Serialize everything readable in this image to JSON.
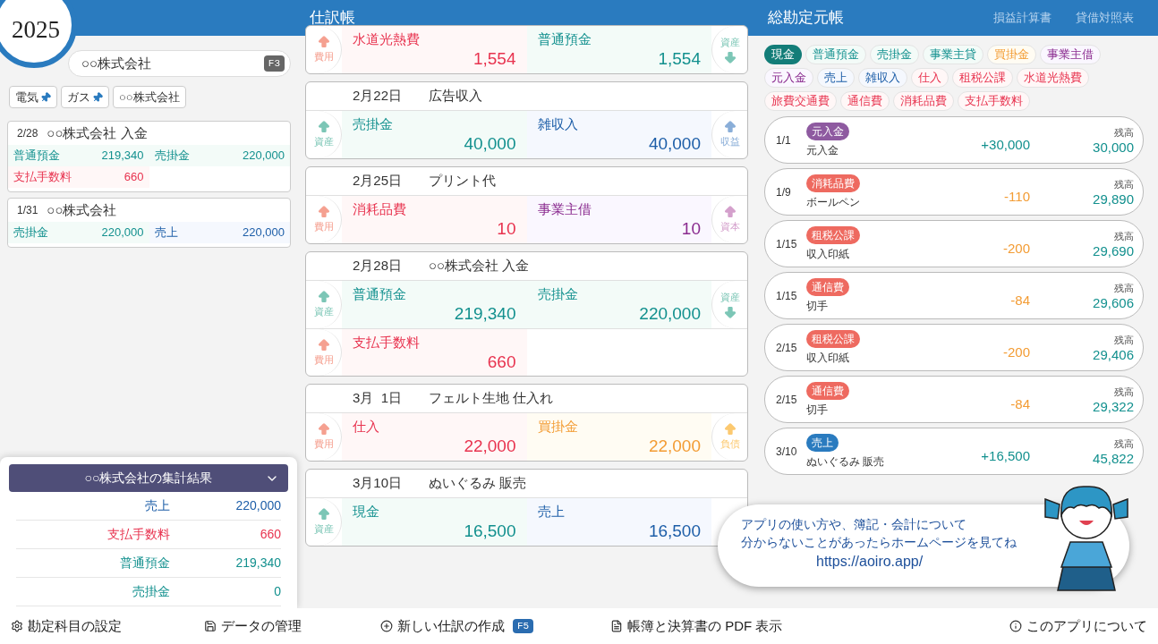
{
  "year": "2025",
  "header": {
    "journal_title": "仕訳帳",
    "ledger_title": "総勘定元帳",
    "links": [
      "損益計算書",
      "貸借対照表"
    ]
  },
  "search": {
    "value": "○○株式会社",
    "shortcut": "F3"
  },
  "chips": [
    {
      "label": "電気",
      "pinned": true
    },
    {
      "label": "ガス",
      "pinned": true
    },
    {
      "label": "○○株式会社",
      "pinned": false
    }
  ],
  "results": [
    {
      "date": "2/28",
      "title": "○○株式会社 入金",
      "cells": [
        {
          "account": "普通預金",
          "amount": "219,340",
          "kind": "asset"
        },
        {
          "account": "売掛金",
          "amount": "220,000",
          "kind": "asset"
        },
        {
          "account": "支払手数料",
          "amount": "660",
          "kind": "expense"
        }
      ]
    },
    {
      "date": "1/31",
      "title": "○○株式会社",
      "cells": [
        {
          "account": "売掛金",
          "amount": "220,000",
          "kind": "asset"
        },
        {
          "account": "売上",
          "amount": "220,000",
          "kind": "revenue"
        }
      ]
    }
  ],
  "summary": {
    "title": "○○株式会社の集計結果",
    "rows": [
      {
        "label": "売上",
        "amount": "220,000",
        "kind": "revenue"
      },
      {
        "label": "支払手数料",
        "amount": "660",
        "kind": "expense"
      },
      {
        "label": "普通預金",
        "amount": "219,340",
        "kind": "asset"
      },
      {
        "label": "売掛金",
        "amount": "0",
        "kind": "asset"
      }
    ]
  },
  "journal": [
    {
      "rows": [
        {
          "left_tag": "費用",
          "left_increase": true,
          "debit": {
            "account": "水道光熱費",
            "amount": "1,554",
            "kind": "expense"
          },
          "credit": {
            "account": "普通預金",
            "amount": "1,554",
            "kind": "asset"
          },
          "right_tag": "資産",
          "right_increase": false
        }
      ]
    },
    {
      "date": "2月22日",
      "title": "広告収入",
      "rows": [
        {
          "left_tag": "資産",
          "left_increase": true,
          "debit": {
            "account": "売掛金",
            "amount": "40,000",
            "kind": "asset"
          },
          "credit": {
            "account": "雑収入",
            "amount": "40,000",
            "kind": "revenue"
          },
          "right_tag": "収益",
          "right_increase": true
        }
      ]
    },
    {
      "date": "2月25日",
      "title": "プリント代",
      "rows": [
        {
          "left_tag": "費用",
          "left_increase": true,
          "debit": {
            "account": "消耗品費",
            "amount": "10",
            "kind": "expense"
          },
          "credit": {
            "account": "事業主借",
            "amount": "10",
            "kind": "equity"
          },
          "right_tag": "資本",
          "right_increase": true
        }
      ]
    },
    {
      "date": "2月28日",
      "title": "○○株式会社 入金",
      "rows": [
        {
          "left_tag": "資産",
          "left_increase": true,
          "debit": {
            "account": "普通預金",
            "amount": "219,340",
            "kind": "asset"
          },
          "credit": {
            "account": "売掛金",
            "amount": "220,000",
            "kind": "asset"
          },
          "right_tag": "資産",
          "right_increase": false
        },
        {
          "left_tag": "費用",
          "left_increase": true,
          "debit": {
            "account": "支払手数料",
            "amount": "660",
            "kind": "expense"
          }
        }
      ]
    },
    {
      "date": "3月  1日",
      "title": "フェルト生地 仕入れ",
      "rows": [
        {
          "left_tag": "費用",
          "left_increase": true,
          "debit": {
            "account": "仕入",
            "amount": "22,000",
            "kind": "expense"
          },
          "credit": {
            "account": "買掛金",
            "amount": "22,000",
            "kind": "liability"
          },
          "right_tag": "負債",
          "right_increase": true
        }
      ]
    },
    {
      "date": "3月10日",
      "title": "ぬいぐるみ 販売",
      "rows": [
        {
          "left_tag": "資産",
          "left_increase": true,
          "debit": {
            "account": "現金",
            "amount": "16,500",
            "kind": "asset"
          },
          "credit": {
            "account": "売上",
            "amount": "16,500",
            "kind": "revenue"
          }
        }
      ]
    }
  ],
  "accounts": [
    {
      "label": "現金",
      "kind": "asset",
      "selected": true
    },
    {
      "label": "普通預金",
      "kind": "asset",
      "selected": false
    },
    {
      "label": "売掛金",
      "kind": "asset",
      "selected": false
    },
    {
      "label": "事業主貸",
      "kind": "asset",
      "selected": false
    },
    {
      "label": "買掛金",
      "kind": "liability",
      "selected": false
    },
    {
      "label": "事業主借",
      "kind": "equity",
      "selected": false
    },
    {
      "label": "元入金",
      "kind": "equity",
      "selected": false
    },
    {
      "label": "売上",
      "kind": "revenue",
      "selected": false
    },
    {
      "label": "雑収入",
      "kind": "revenue",
      "selected": false
    },
    {
      "label": "仕入",
      "kind": "expense",
      "selected": false
    },
    {
      "label": "租税公課",
      "kind": "expense",
      "selected": false
    },
    {
      "label": "水道光熱費",
      "kind": "expense",
      "selected": false
    },
    {
      "label": "旅費交通費",
      "kind": "expense",
      "selected": false
    },
    {
      "label": "通信費",
      "kind": "expense",
      "selected": false
    },
    {
      "label": "消耗品費",
      "kind": "expense",
      "selected": false
    },
    {
      "label": "支払手数料",
      "kind": "expense",
      "selected": false
    }
  ],
  "ledger": [
    {
      "date": "1/1",
      "tag": {
        "label": "元入金",
        "kind": "equity"
      },
      "memo": "元入金",
      "change": {
        "value": "+30,000",
        "kind": "increase"
      },
      "balance_label": "残高",
      "balance": "30,000"
    },
    {
      "date": "1/9",
      "tag": {
        "label": "消耗品費",
        "kind": "expense"
      },
      "memo": "ボールペン",
      "change": {
        "value": "-110",
        "kind": "decrease"
      },
      "balance_label": "残高",
      "balance": "29,890"
    },
    {
      "date": "1/15",
      "tag": {
        "label": "租税公課",
        "kind": "expense"
      },
      "memo": "収入印紙",
      "change": {
        "value": "-200",
        "kind": "decrease"
      },
      "balance_label": "残高",
      "balance": "29,690"
    },
    {
      "date": "1/15",
      "tag": {
        "label": "通信費",
        "kind": "expense"
      },
      "memo": "切手",
      "change": {
        "value": "-84",
        "kind": "decrease"
      },
      "balance_label": "残高",
      "balance": "29,606"
    },
    {
      "date": "2/15",
      "tag": {
        "label": "租税公課",
        "kind": "expense"
      },
      "memo": "収入印紙",
      "change": {
        "value": "-200",
        "kind": "decrease"
      },
      "balance_label": "残高",
      "balance": "29,406"
    },
    {
      "date": "2/15",
      "tag": {
        "label": "通信費",
        "kind": "expense"
      },
      "memo": "切手",
      "change": {
        "value": "-84",
        "kind": "decrease"
      },
      "balance_label": "残高",
      "balance": "29,322"
    },
    {
      "date": "3/10",
      "tag": {
        "label": "売上",
        "kind": "revenue"
      },
      "memo": "ぬいぐるみ 販売",
      "change": {
        "value": "+16,500",
        "kind": "increase"
      },
      "balance_label": "残高",
      "balance": "45,822"
    }
  ],
  "help_bubble": {
    "lines": [
      "アプリの使い方や、簿記・会計について",
      "分からないことがあったらホームページを見てね"
    ],
    "url": "https://aoiro.app/"
  },
  "footer": [
    {
      "kind": "settings",
      "label": "勘定科目の設定"
    },
    {
      "kind": "save",
      "label": "データの管理"
    },
    {
      "kind": "add",
      "label": "新しい仕訳の作成",
      "shortcut": "F5"
    },
    {
      "kind": "document",
      "label": "帳簿と決算書の PDF 表示"
    },
    {
      "kind": "info",
      "label": "このアプリについて"
    }
  ]
}
